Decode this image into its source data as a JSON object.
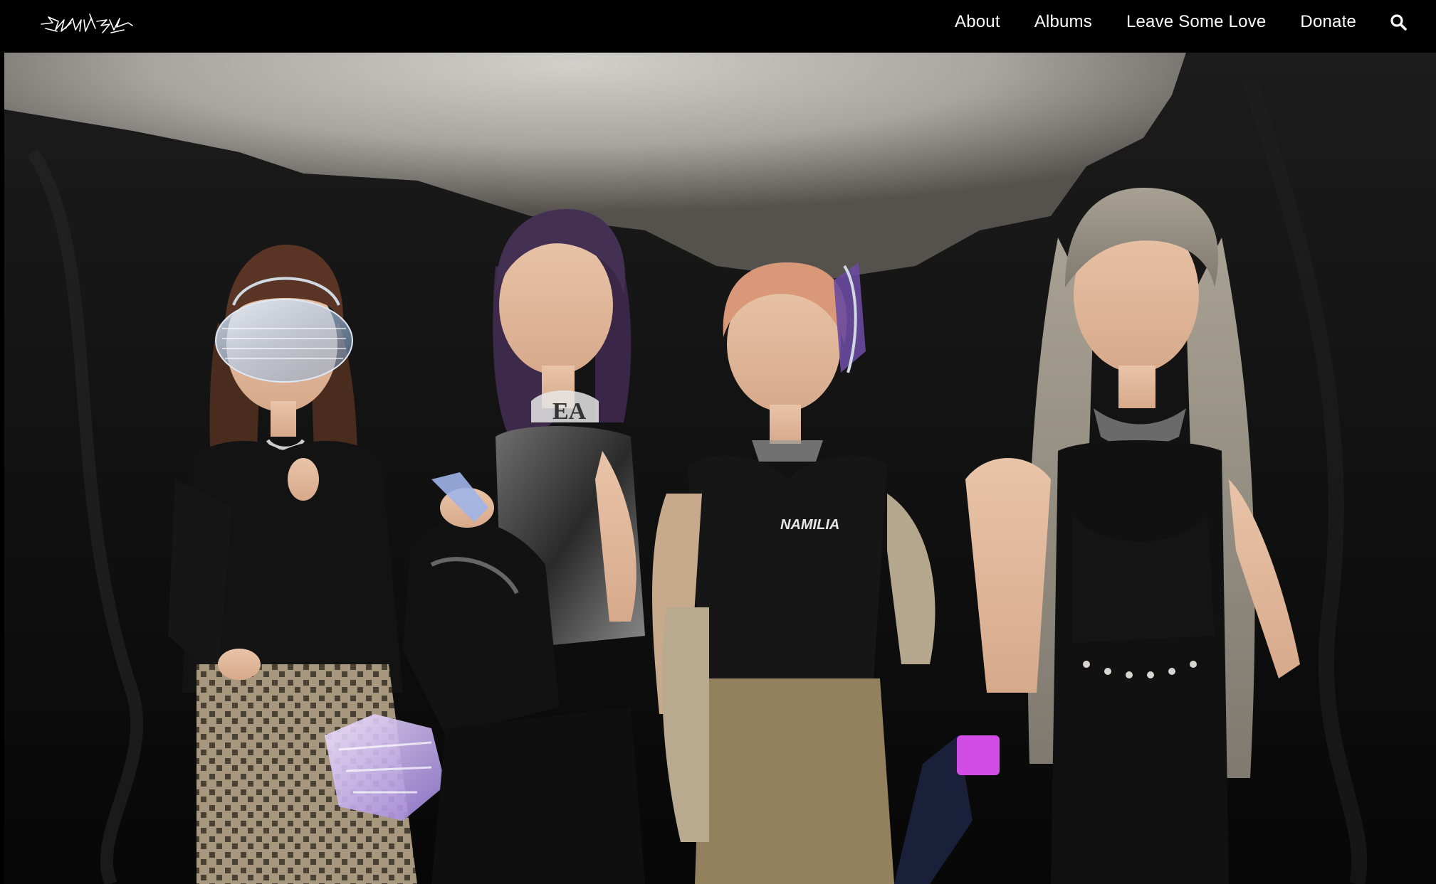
{
  "header": {
    "logo_alt": "Savage",
    "nav": [
      {
        "label": "About"
      },
      {
        "label": "Albums"
      },
      {
        "label": "Leave Some Love"
      },
      {
        "label": "Donate"
      }
    ],
    "search_icon": "search-icon"
  },
  "hero": {
    "image_alt": "Group photo of four members in black outfits against a dark draped backdrop",
    "shirt_text": "NAMILIA",
    "necklace_text": "EA"
  },
  "colors": {
    "nav_bg": "#000000",
    "nav_text": "#ffffff",
    "backdrop_light": "#c9c6c1",
    "backdrop_dark": "#0d0d0d"
  }
}
